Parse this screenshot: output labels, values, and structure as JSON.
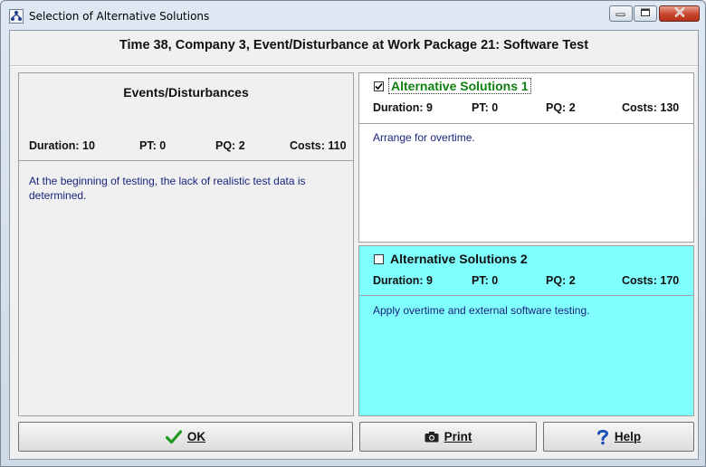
{
  "window": {
    "title": "Selection of Alternative Solutions",
    "icon": "hierarchy-app-icon",
    "controls": {
      "minimize": "minimize-icon",
      "maximize": "maximize-icon",
      "close": "close-icon"
    }
  },
  "header": {
    "title": "Time 38, Company 3, Event/Disturbance at Work Package 21: Software Test"
  },
  "event": {
    "heading": "Events/Disturbances",
    "duration": "Duration: 10",
    "pt": "PT: 0",
    "pq": "PQ: 2",
    "costs": "Costs: 110",
    "description": "At the beginning of testing, the lack of realistic test data is determined."
  },
  "alternatives": [
    {
      "title": "Alternative Solutions 1",
      "checked": true,
      "duration": "Duration: 9",
      "pt": "PT: 0",
      "pq": "PQ: 2",
      "costs": "Costs: 130",
      "description": "Arrange for overtime.",
      "background": "#ffffff",
      "title_color": "#108010"
    },
    {
      "title": "Alternative Solutions 2",
      "checked": false,
      "duration": "Duration: 9",
      "pt": "PT: 0",
      "pq": "PQ: 2",
      "costs": "Costs: 170",
      "description": "Apply overtime and external software testing.",
      "background": "#80ffff",
      "title_color": "#111111"
    }
  ],
  "buttons": {
    "ok": {
      "label": "OK",
      "icon": "checkmark-icon"
    },
    "print": {
      "label": "Print",
      "icon": "camera-icon"
    },
    "help": {
      "label": "Help",
      "icon": "question-mark-icon"
    }
  }
}
